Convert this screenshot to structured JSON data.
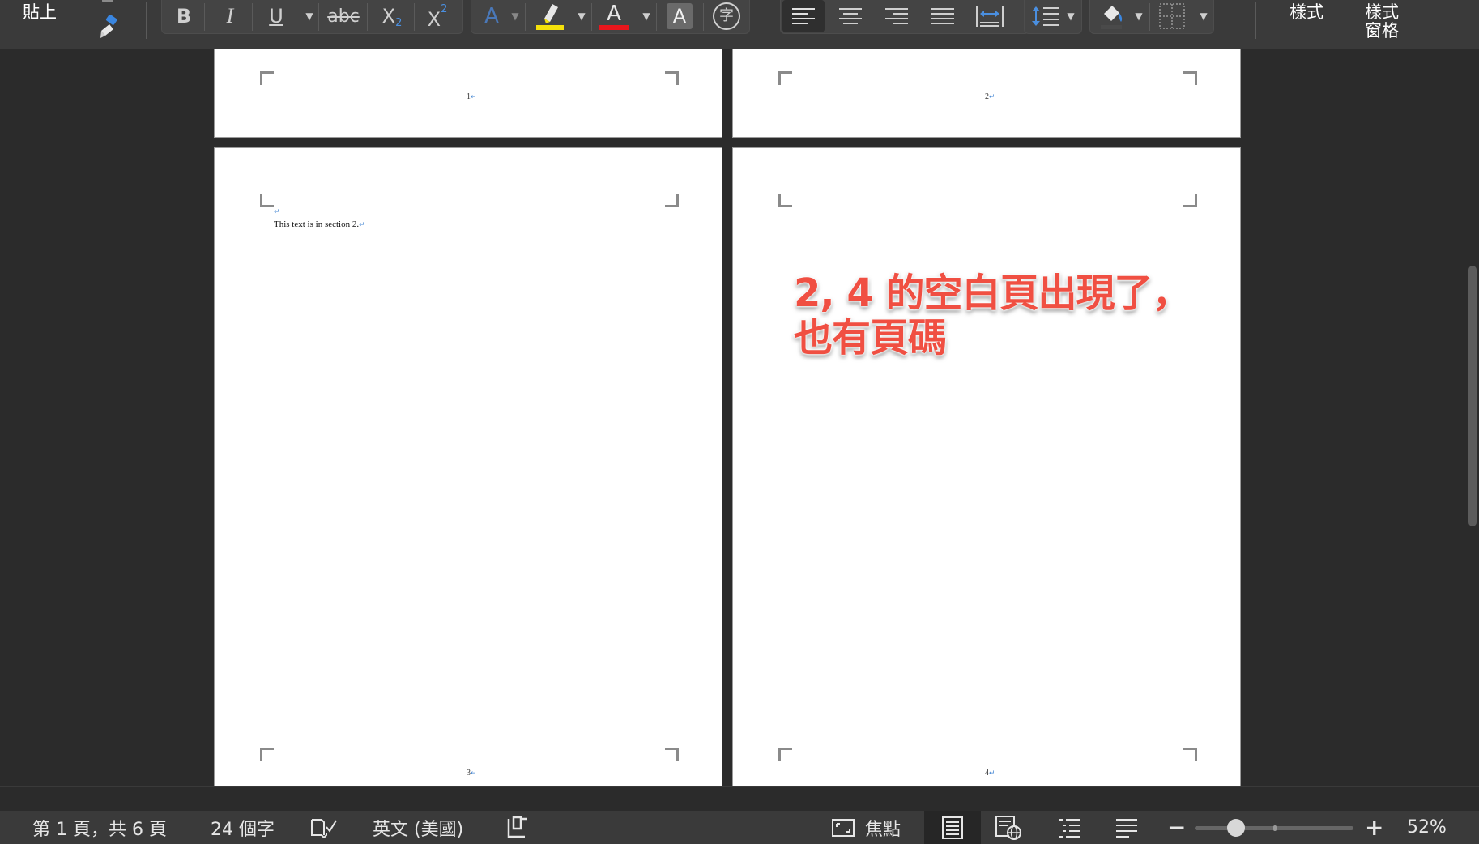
{
  "ribbon": {
    "paste_label": "貼上",
    "bold": "B",
    "italic": "I",
    "underline": "U",
    "strikethrough": "abc",
    "subscript_base": "X",
    "subscript_mark": "2",
    "superscript_base": "X",
    "superscript_mark": "2",
    "text_effects": "A",
    "font_color": "A",
    "char_shading": "A",
    "enclose_char": "字",
    "styles_label": "樣式",
    "styles_pane_line1": "樣式",
    "styles_pane_line2": "窗格",
    "colors": {
      "highlight": "#f5e10b",
      "font_color": "#e8161c",
      "accent_blue": "#4a8fe0"
    }
  },
  "document": {
    "pages": [
      {
        "number": "1",
        "body": ""
      },
      {
        "number": "2",
        "body": ""
      },
      {
        "number": "3",
        "body": "This text is in section 2."
      },
      {
        "number": "4",
        "body": ""
      }
    ],
    "annotation_line1": "2, 4 的空白頁出現了，",
    "annotation_line2": "也有頁碼",
    "annotation_color": "#f04f42"
  },
  "status_bar": {
    "page_info": "第 1 頁，共 6 頁",
    "word_count": "24 個字",
    "language": "英文 (美國)",
    "focus_label": "焦點",
    "zoom_minus": "−",
    "zoom_plus": "+",
    "zoom_level": "52%",
    "zoom_fraction": 0.26
  },
  "icons": {
    "format_painter": "paintbrush-icon",
    "align_left": "align-left-icon",
    "align_center": "align-center-icon",
    "align_right": "align-right-icon",
    "justify": "justify-icon",
    "distributed": "distributed-icon",
    "line_spacing": "line-spacing-icon",
    "shading": "paint-bucket-icon",
    "borders": "borders-icon",
    "proofing": "proofing-book-icon",
    "track_changes": "track-changes-icon",
    "focus": "focus-icon",
    "print_layout": "print-layout-icon",
    "web_layout": "web-layout-icon",
    "outline": "outline-icon",
    "draft": "draft-icon"
  }
}
